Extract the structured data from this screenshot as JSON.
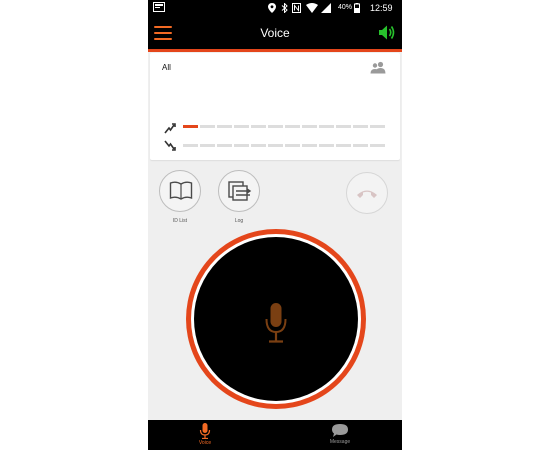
{
  "status_bar": {
    "battery": "40%",
    "time": "12:59"
  },
  "header": {
    "title": "Voice"
  },
  "channel": {
    "label": "All",
    "tx_level_segments_active": 1,
    "segments_total": 12
  },
  "actions": {
    "id_list_label": "ID List",
    "log_label": "Log"
  },
  "nav": {
    "voice_label": "Voice",
    "message_label": "Message"
  },
  "colors": {
    "accent": "#e4461b",
    "orange": "#f26a24",
    "green": "#27c12c",
    "mic": "#7a3f12",
    "inactive": "#9a9a9a"
  }
}
